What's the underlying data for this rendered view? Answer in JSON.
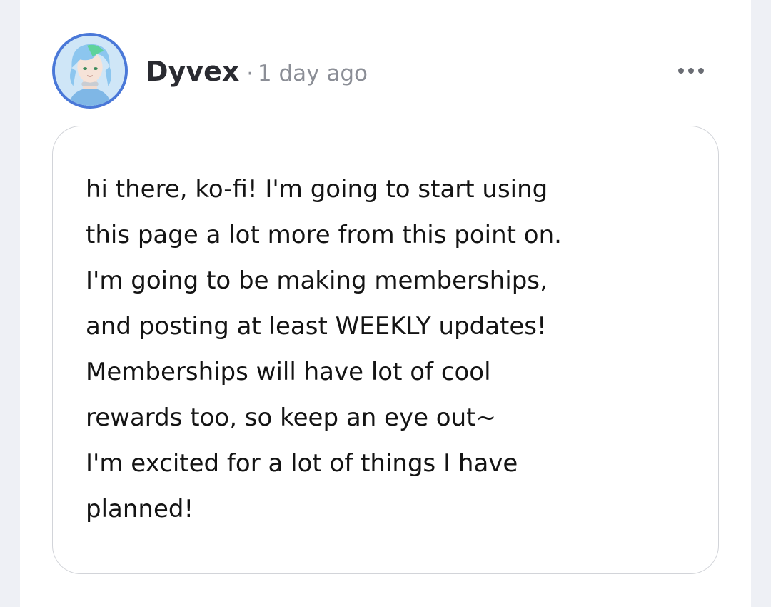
{
  "post": {
    "author": {
      "name": "Dyvex",
      "separator": "·",
      "timestamp": "1 day ago",
      "avatar_icon": "user-avatar-icon"
    },
    "more_icon": "more-horizontal-icon",
    "body_lines": [
      "hi there, ko-fi! I'm going to start using",
      "this page a lot more from this point on.",
      "I'm going to be making memberships,",
      "and posting at least WEEKLY updates!",
      "Memberships will have lot of cool",
      "rewards too, so keep an eye out~",
      "I'm excited for a lot of things I have",
      "planned!"
    ]
  },
  "colors": {
    "page_background": "#eef0f5",
    "card_background": "#ffffff",
    "avatar_ring": "#4a78d8",
    "author_text": "#2a2b31",
    "muted_text": "#8b8e96",
    "body_text": "#141414",
    "box_border": "#d2d4d9"
  }
}
